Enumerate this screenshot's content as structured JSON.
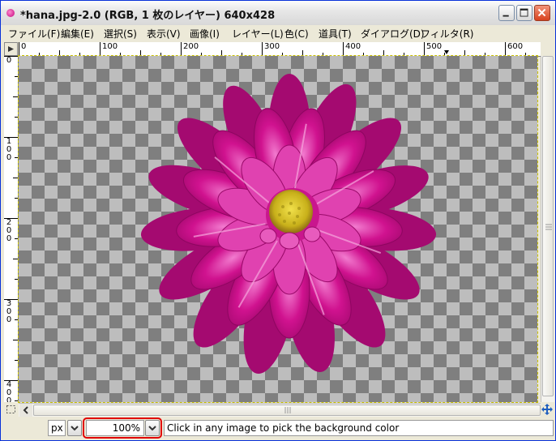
{
  "window": {
    "title": "*hana.jpg-2.0 (RGB, 1 枚のレイヤー) 640x428",
    "buttons": {
      "minimize": "minimize-icon",
      "maximize": "maximize-icon",
      "close": "close-icon"
    }
  },
  "menubar": {
    "items": [
      {
        "label": "ファイル(F)"
      },
      {
        "label": "編集(E)"
      },
      {
        "label": "選択(S)"
      },
      {
        "label": "表示(V)"
      },
      {
        "label": "画像(I)"
      },
      {
        "label": "レイヤー(L)"
      },
      {
        "label": "色(C)"
      },
      {
        "label": "道具(T)"
      },
      {
        "label": "ダイアログ(D)"
      },
      {
        "label": "フィルタ(R)"
      }
    ]
  },
  "rulers": {
    "horizontal_labels": [
      "0",
      "100",
      "200",
      "300",
      "400",
      "500",
      "600"
    ],
    "vertical_labels": [
      "0",
      "100",
      "200",
      "300",
      "400"
    ]
  },
  "canvas": {
    "image_description_icon": "dahlia-flower-image",
    "flower_color": "#d0128f",
    "center_color": "#d6c21a"
  },
  "statusbar": {
    "unit": "px",
    "zoom": "100%",
    "message": "Click in any image to pick the background color"
  },
  "colors": {
    "highlight": "#e10000",
    "checker_dark": "#7f7f7f",
    "checker_light": "#bdbdbd"
  }
}
